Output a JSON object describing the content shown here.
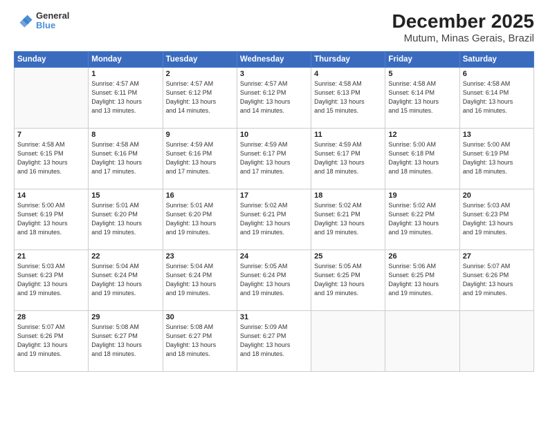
{
  "header": {
    "logo": {
      "line1": "General",
      "line2": "Blue"
    },
    "title": "December 2025",
    "subtitle": "Mutum, Minas Gerais, Brazil"
  },
  "weekdays": [
    "Sunday",
    "Monday",
    "Tuesday",
    "Wednesday",
    "Thursday",
    "Friday",
    "Saturday"
  ],
  "weeks": [
    [
      {
        "day": "",
        "content": ""
      },
      {
        "day": "1",
        "content": "Sunrise: 4:57 AM\nSunset: 6:11 PM\nDaylight: 13 hours\nand 13 minutes."
      },
      {
        "day": "2",
        "content": "Sunrise: 4:57 AM\nSunset: 6:12 PM\nDaylight: 13 hours\nand 14 minutes."
      },
      {
        "day": "3",
        "content": "Sunrise: 4:57 AM\nSunset: 6:12 PM\nDaylight: 13 hours\nand 14 minutes."
      },
      {
        "day": "4",
        "content": "Sunrise: 4:58 AM\nSunset: 6:13 PM\nDaylight: 13 hours\nand 15 minutes."
      },
      {
        "day": "5",
        "content": "Sunrise: 4:58 AM\nSunset: 6:14 PM\nDaylight: 13 hours\nand 15 minutes."
      },
      {
        "day": "6",
        "content": "Sunrise: 4:58 AM\nSunset: 6:14 PM\nDaylight: 13 hours\nand 16 minutes."
      }
    ],
    [
      {
        "day": "7",
        "content": "Sunrise: 4:58 AM\nSunset: 6:15 PM\nDaylight: 13 hours\nand 16 minutes."
      },
      {
        "day": "8",
        "content": "Sunrise: 4:58 AM\nSunset: 6:16 PM\nDaylight: 13 hours\nand 17 minutes."
      },
      {
        "day": "9",
        "content": "Sunrise: 4:59 AM\nSunset: 6:16 PM\nDaylight: 13 hours\nand 17 minutes."
      },
      {
        "day": "10",
        "content": "Sunrise: 4:59 AM\nSunset: 6:17 PM\nDaylight: 13 hours\nand 17 minutes."
      },
      {
        "day": "11",
        "content": "Sunrise: 4:59 AM\nSunset: 6:17 PM\nDaylight: 13 hours\nand 18 minutes."
      },
      {
        "day": "12",
        "content": "Sunrise: 5:00 AM\nSunset: 6:18 PM\nDaylight: 13 hours\nand 18 minutes."
      },
      {
        "day": "13",
        "content": "Sunrise: 5:00 AM\nSunset: 6:19 PM\nDaylight: 13 hours\nand 18 minutes."
      }
    ],
    [
      {
        "day": "14",
        "content": "Sunrise: 5:00 AM\nSunset: 6:19 PM\nDaylight: 13 hours\nand 18 minutes."
      },
      {
        "day": "15",
        "content": "Sunrise: 5:01 AM\nSunset: 6:20 PM\nDaylight: 13 hours\nand 19 minutes."
      },
      {
        "day": "16",
        "content": "Sunrise: 5:01 AM\nSunset: 6:20 PM\nDaylight: 13 hours\nand 19 minutes."
      },
      {
        "day": "17",
        "content": "Sunrise: 5:02 AM\nSunset: 6:21 PM\nDaylight: 13 hours\nand 19 minutes."
      },
      {
        "day": "18",
        "content": "Sunrise: 5:02 AM\nSunset: 6:21 PM\nDaylight: 13 hours\nand 19 minutes."
      },
      {
        "day": "19",
        "content": "Sunrise: 5:02 AM\nSunset: 6:22 PM\nDaylight: 13 hours\nand 19 minutes."
      },
      {
        "day": "20",
        "content": "Sunrise: 5:03 AM\nSunset: 6:23 PM\nDaylight: 13 hours\nand 19 minutes."
      }
    ],
    [
      {
        "day": "21",
        "content": "Sunrise: 5:03 AM\nSunset: 6:23 PM\nDaylight: 13 hours\nand 19 minutes."
      },
      {
        "day": "22",
        "content": "Sunrise: 5:04 AM\nSunset: 6:24 PM\nDaylight: 13 hours\nand 19 minutes."
      },
      {
        "day": "23",
        "content": "Sunrise: 5:04 AM\nSunset: 6:24 PM\nDaylight: 13 hours\nand 19 minutes."
      },
      {
        "day": "24",
        "content": "Sunrise: 5:05 AM\nSunset: 6:24 PM\nDaylight: 13 hours\nand 19 minutes."
      },
      {
        "day": "25",
        "content": "Sunrise: 5:05 AM\nSunset: 6:25 PM\nDaylight: 13 hours\nand 19 minutes."
      },
      {
        "day": "26",
        "content": "Sunrise: 5:06 AM\nSunset: 6:25 PM\nDaylight: 13 hours\nand 19 minutes."
      },
      {
        "day": "27",
        "content": "Sunrise: 5:07 AM\nSunset: 6:26 PM\nDaylight: 13 hours\nand 19 minutes."
      }
    ],
    [
      {
        "day": "28",
        "content": "Sunrise: 5:07 AM\nSunset: 6:26 PM\nDaylight: 13 hours\nand 19 minutes."
      },
      {
        "day": "29",
        "content": "Sunrise: 5:08 AM\nSunset: 6:27 PM\nDaylight: 13 hours\nand 18 minutes."
      },
      {
        "day": "30",
        "content": "Sunrise: 5:08 AM\nSunset: 6:27 PM\nDaylight: 13 hours\nand 18 minutes."
      },
      {
        "day": "31",
        "content": "Sunrise: 5:09 AM\nSunset: 6:27 PM\nDaylight: 13 hours\nand 18 minutes."
      },
      {
        "day": "",
        "content": ""
      },
      {
        "day": "",
        "content": ""
      },
      {
        "day": "",
        "content": ""
      }
    ]
  ]
}
